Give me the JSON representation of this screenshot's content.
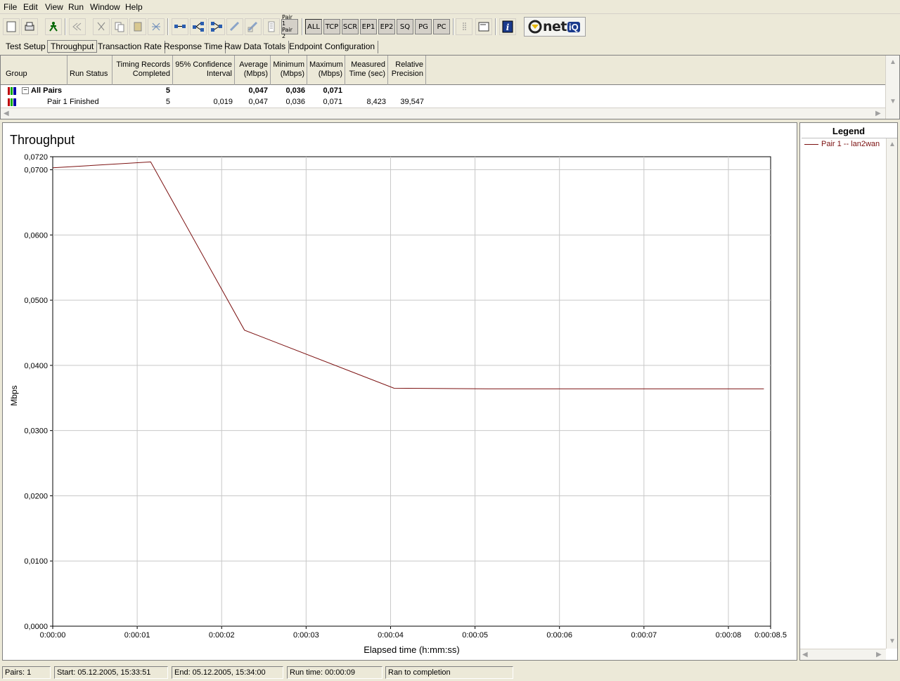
{
  "menu": [
    "File",
    "Edit",
    "View",
    "Run",
    "Window",
    "Help"
  ],
  "toolbar": {
    "pair_button": {
      "line1": "Pair 1",
      "line2": "Pair 2"
    },
    "text_buttons": [
      "ALL",
      "TCP",
      "SCR",
      "EP1",
      "EP2",
      "SQ",
      "PG",
      "PC"
    ],
    "logo_prefix": "net",
    "logo_suffix": "iQ"
  },
  "tabs": [
    "Test Setup",
    "Throughput",
    "Transaction Rate",
    "Response Time",
    "Raw Data Totals",
    "Endpoint Configuration"
  ],
  "active_tab": "Throughput",
  "table": {
    "columns": [
      {
        "line1": "",
        "line2": "Group"
      },
      {
        "line1": "",
        "line2": "Run Status"
      },
      {
        "line1": "Timing Records",
        "line2": "Completed"
      },
      {
        "line1": "95% Confidence",
        "line2": "Interval"
      },
      {
        "line1": "Average",
        "line2": "(Mbps)"
      },
      {
        "line1": "Minimum",
        "line2": "(Mbps)"
      },
      {
        "line1": "Maximum",
        "line2": "(Mbps)"
      },
      {
        "line1": "Measured",
        "line2": "Time (sec)"
      },
      {
        "line1": "Relative",
        "line2": "Precision"
      }
    ],
    "rows": [
      {
        "group": "All Pairs",
        "status": "",
        "records": "5",
        "ci": "",
        "avg": "0,047",
        "min": "0,036",
        "max": "0,071",
        "time": "",
        "precision": "",
        "bold": true
      },
      {
        "group": "Pair 1",
        "status": "Finished",
        "records": "5",
        "ci": "0,019",
        "avg": "0,047",
        "min": "0,036",
        "max": "0,071",
        "time": "8,423",
        "precision": "39,547",
        "bold": false
      }
    ]
  },
  "chart_data": {
    "type": "line",
    "title": "Throughput",
    "xlabel": "Elapsed time (h:mm:ss)",
    "ylabel": "Mbps",
    "xlim": [
      0,
      8.5
    ],
    "ylim": [
      0,
      0.072
    ],
    "x_ticks": [
      {
        "v": 0,
        "label": "0:00:00"
      },
      {
        "v": 1,
        "label": "0:00:01"
      },
      {
        "v": 2,
        "label": "0:00:02"
      },
      {
        "v": 3,
        "label": "0:00:03"
      },
      {
        "v": 4,
        "label": "0:00:04"
      },
      {
        "v": 5,
        "label": "0:00:05"
      },
      {
        "v": 6,
        "label": "0:00:06"
      },
      {
        "v": 7,
        "label": "0:00:07"
      },
      {
        "v": 8,
        "label": "0:00:08"
      },
      {
        "v": 8.5,
        "label": "0:00:08.5"
      }
    ],
    "y_ticks": [
      {
        "v": 0,
        "label": "0,0000"
      },
      {
        "v": 0.01,
        "label": "0,0100"
      },
      {
        "v": 0.02,
        "label": "0,0200"
      },
      {
        "v": 0.03,
        "label": "0,0300"
      },
      {
        "v": 0.04,
        "label": "0,0400"
      },
      {
        "v": 0.05,
        "label": "0,0500"
      },
      {
        "v": 0.06,
        "label": "0,0600"
      },
      {
        "v": 0.07,
        "label": "0,0700"
      },
      {
        "v": 0.072,
        "label": "0,0720"
      }
    ],
    "grid": true,
    "series": [
      {
        "name": "Pair 1 -- lan2wan",
        "color": "#7b1010",
        "points": [
          [
            0,
            0.0703
          ],
          [
            1.16,
            0.0712
          ],
          [
            2.27,
            0.0454
          ],
          [
            4.04,
            0.0365
          ],
          [
            5.15,
            0.0364
          ],
          [
            8.42,
            0.0364
          ]
        ]
      }
    ],
    "legend_title": "Legend"
  },
  "status": {
    "pairs": "Pairs: 1",
    "start": "Start: 05.12.2005, 15:33:51",
    "end": "End: 05.12.2005, 15:34:00",
    "runtime": "Run time: 00:00:09",
    "result": "Ran to completion"
  }
}
